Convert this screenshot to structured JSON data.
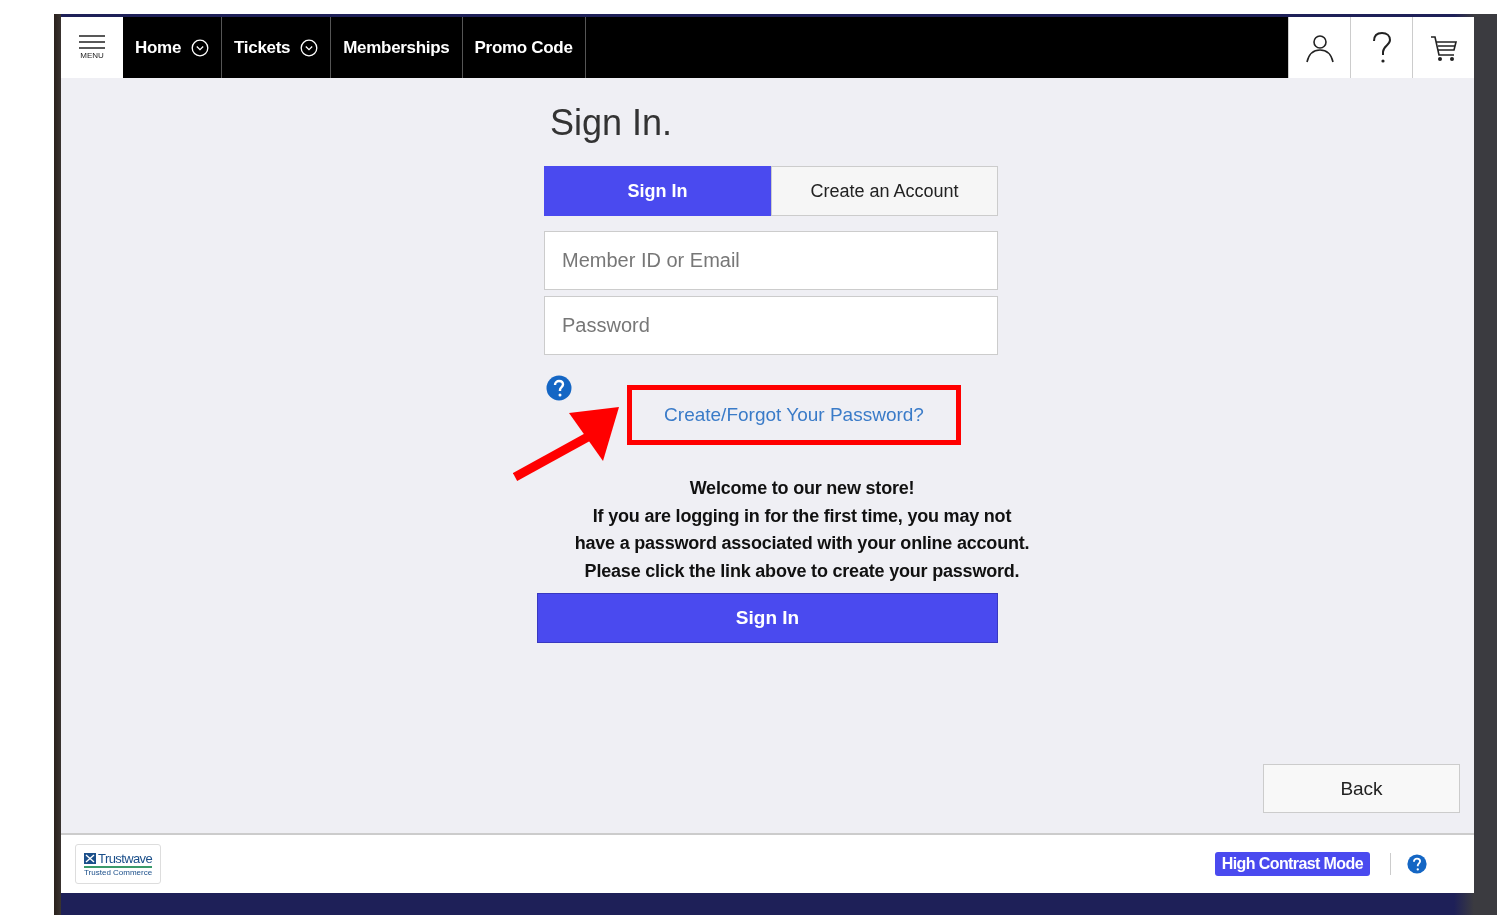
{
  "nav": {
    "menu_label": "MENU",
    "items": [
      {
        "label": "Home",
        "dropdown": true
      },
      {
        "label": "Tickets",
        "dropdown": true
      },
      {
        "label": "Memberships",
        "dropdown": false
      },
      {
        "label": "Promo Code",
        "dropdown": false
      }
    ]
  },
  "heading": "Sign In.",
  "tabs": [
    {
      "label": "Sign In",
      "selected": true
    },
    {
      "label": "Create an Account",
      "selected": false
    }
  ],
  "fields": [
    {
      "placeholder": "Member ID or Email"
    },
    {
      "placeholder": "Password"
    }
  ],
  "forgot_link": {
    "label": "Create/Forgot Your Password?",
    "highlighted": true
  },
  "message_lines": [
    "Welcome to our new store!",
    "If you are logging in for the first time, you may not",
    "have a password associated with your online account.",
    "Please click the link above to create your password."
  ],
  "submit_button": "Sign In",
  "back_button": "Back",
  "footer": {
    "trust_badge": {
      "name": "Trustwave",
      "tagline": "Trusted Commerce"
    },
    "high_contrast_button": "High Contrast Mode"
  }
}
